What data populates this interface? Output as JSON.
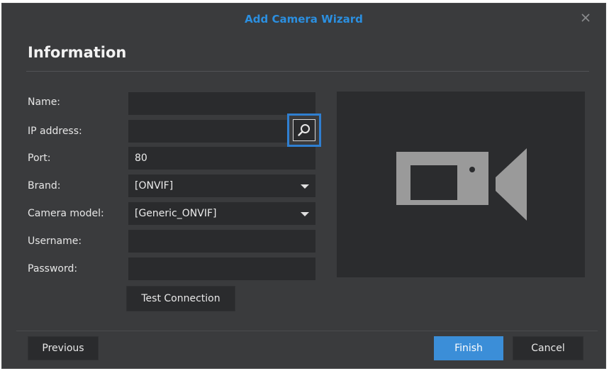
{
  "dialog": {
    "title": "Add Camera Wizard",
    "heading": "Information",
    "close_icon": "close-icon"
  },
  "form": {
    "name": {
      "label": "Name:",
      "value": ""
    },
    "ip_address": {
      "label": "IP address:",
      "value": "",
      "search_icon": "search-icon"
    },
    "port": {
      "label": "Port:",
      "value": "80"
    },
    "brand": {
      "label": "Brand:",
      "value": "[ONVIF]"
    },
    "camera_model": {
      "label": "Camera model:",
      "value": "[Generic_ONVIF]"
    },
    "username": {
      "label": "Username:",
      "value": ""
    },
    "password": {
      "label": "Password:",
      "value": ""
    },
    "test_connection_label": "Test Connection"
  },
  "preview": {
    "icon": "video-camera-icon"
  },
  "footer": {
    "previous_label": "Previous",
    "finish_label": "Finish",
    "cancel_label": "Cancel"
  },
  "colors": {
    "dialog_bg": "#3a3b3d",
    "field_bg": "#2a2b2d",
    "title_accent": "#2b8fe0",
    "highlight_border": "#2f7fd1",
    "primary_button": "#3b8ed8",
    "camera_icon": "#9a9a9a"
  }
}
